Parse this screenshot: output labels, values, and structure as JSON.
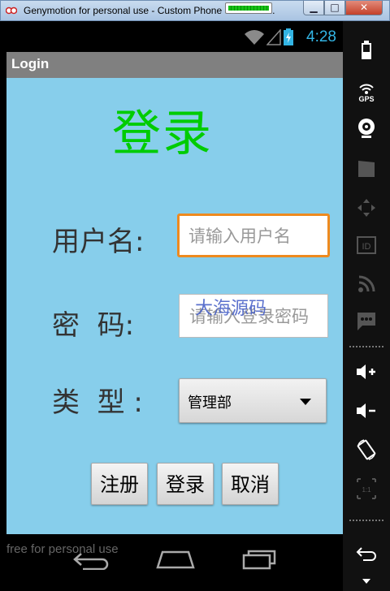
{
  "window": {
    "title": "Genymotion for personal use - Custom Phone - 4.2.2 - A..."
  },
  "status_bar": {
    "time": "4:28"
  },
  "action_bar": {
    "title": "Login"
  },
  "form": {
    "heading": "登录",
    "username": {
      "label": "用户名:",
      "placeholder": "请输入用户名"
    },
    "password": {
      "label": "密  码:",
      "placeholder": "请输入登录密码"
    },
    "type": {
      "label": "类  型 :",
      "selected": "管理部"
    },
    "buttons": {
      "register": "注册",
      "login": "登录",
      "cancel": "取消"
    }
  },
  "watermark": "大海源码",
  "footer": {
    "free_text": "free for personal use"
  },
  "sidebar": {
    "items": [
      "battery-icon",
      "gps-icon",
      "webcam-icon",
      "video-icon",
      "dpad-icon",
      "id-icon",
      "rss-icon",
      "sms-icon",
      "volume-up-icon",
      "volume-down-icon",
      "rotate-icon",
      "scale-icon",
      "back-icon"
    ],
    "gps_label": "GPS",
    "id_label": "ID",
    "scale_label": "1:1"
  },
  "colors": {
    "content_bg": "#87ceeb",
    "heading": "#00cc00",
    "time": "#33b5e5",
    "focus_border": "#ee8a1f",
    "watermark": "#4a62c8"
  }
}
